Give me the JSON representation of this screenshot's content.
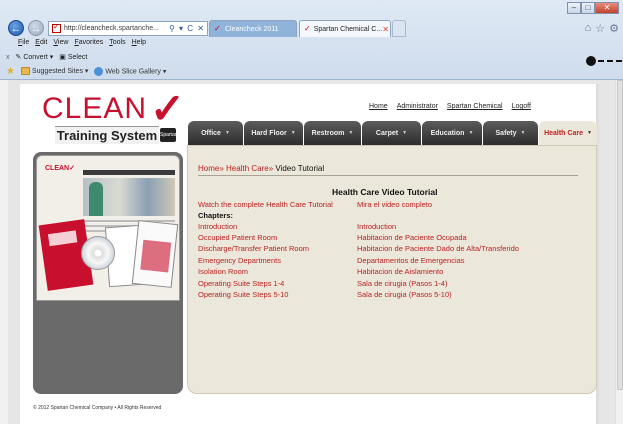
{
  "browser": {
    "address": {
      "url_prefix": "http://cleancheck.",
      "url_host": "spartanche...",
      "icons": "⚲ ▾ C ✕"
    },
    "tabs": [
      {
        "label": "Cleancheck 2011"
      },
      {
        "label": "Spartan Chemical C..."
      }
    ],
    "menu": [
      "File",
      "Edit",
      "View",
      "Favorites",
      "Tools",
      "Help"
    ],
    "command_bar": {
      "convert": "Convert",
      "select": "Select"
    },
    "favorites_bar": {
      "suggested": "Suggested Sites ▾",
      "gallery": "Web Slice Gallery ▾"
    }
  },
  "site": {
    "logo": {
      "word": "CLEAN",
      "subtitle": "Training System",
      "badge": "Spartan"
    },
    "top_links": [
      "Home",
      "Administrator",
      "Spartan Chemical",
      "Logoff"
    ],
    "nav_tabs": [
      {
        "label": "Office",
        "active": false
      },
      {
        "label": "Hard Floor",
        "active": false
      },
      {
        "label": "Restroom",
        "active": false
      },
      {
        "label": "Carpet",
        "active": false
      },
      {
        "label": "Education",
        "active": false
      },
      {
        "label": "Safety",
        "active": false
      },
      {
        "label": "Health Care",
        "active": true
      }
    ],
    "breadcrumb": {
      "home": "Home",
      "sep1": "» ",
      "section": "Health Care",
      "sep2": "» ",
      "current": "Video Tutorial"
    },
    "content": {
      "title": "Health Care Video Tutorial",
      "watch_en": "Watch the complete Health Care Tutorial",
      "watch_es": "Mira el video completo",
      "chapters_label": "Chapters:",
      "chapters": [
        {
          "en": "Introduction",
          "es": "Introduction"
        },
        {
          "en": "Occupied Patient Room",
          "es": "Habitacion de Paciente Ocupada"
        },
        {
          "en": "Discharge/Transfer Patient Room",
          "es": "Habitacion de Paciente Dado de Alta/Transferido"
        },
        {
          "en": "Emergency Departments",
          "es": "Departamentos de Emergencias"
        },
        {
          "en": "Isolation Room",
          "es": "Habitacion de Aislamiento"
        },
        {
          "en": "Operating Suite Steps 1-4",
          "es": "Sala de cirugia (Pasos 1-4)"
        },
        {
          "en": "Operating Suite Steps 5-10",
          "es": "Sala de cirugia (Pasos 5-10)"
        }
      ]
    },
    "footer": "© 2012 Spartan Chemical Company • All Rights Reserved",
    "colors": {
      "brand_red": "#c8102e",
      "link_red": "#b22222",
      "tab_dark": "#2c2c2c",
      "content_bg": "#ebe7da"
    }
  }
}
